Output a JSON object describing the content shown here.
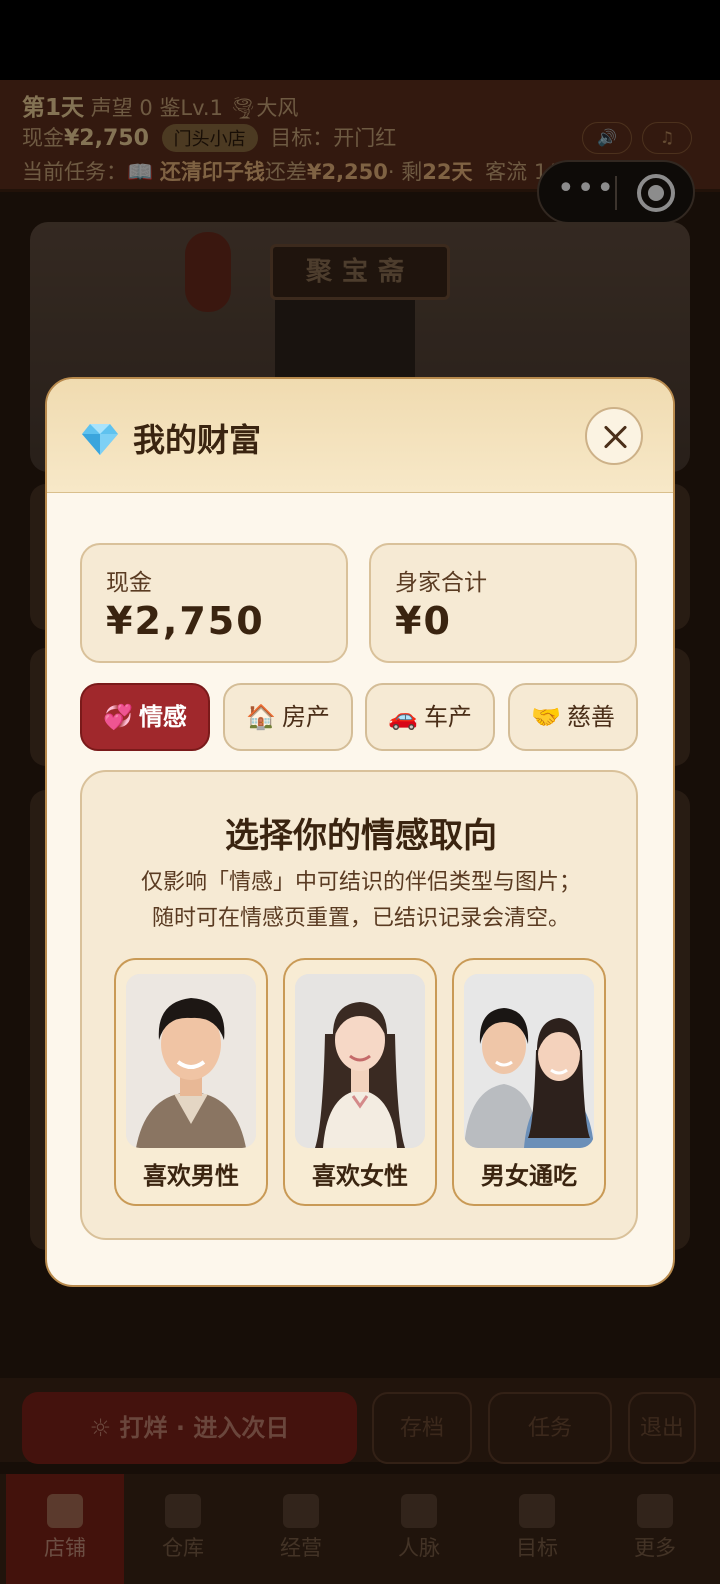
{
  "topbar": {
    "day": "第1天",
    "reputation": "声望 0",
    "appraisal": "鉴Lv.1",
    "weather_icon": "wind-icon",
    "weather": "大风",
    "cash_label": "现金",
    "cash_value": "¥2,750",
    "shop_badge": "门头小店",
    "goal": "目标：开门红",
    "task_label": "当前任务：",
    "task_icon": "book-icon",
    "task_name": "还清印子钱",
    "task_progress": "还差",
    "task_amount": "¥2,250",
    "task_sep": "· 剩",
    "task_days": "22天",
    "customer_count": "客流 1/2"
  },
  "scene": {
    "shop_sign": "聚宝斋"
  },
  "actions": {
    "next_day": "☼ 打烊 · 进入次日",
    "save": "存档",
    "task": "任务",
    "exit": "退出"
  },
  "tabs": [
    {
      "label": "店铺",
      "icon": "shop-icon",
      "active": true
    },
    {
      "label": "仓库",
      "icon": "warehouse-icon"
    },
    {
      "label": "经营",
      "icon": "business-icon"
    },
    {
      "label": "人脉",
      "icon": "people-icon"
    },
    {
      "label": "目标",
      "icon": "target-icon"
    },
    {
      "label": "更多",
      "icon": "more-icon"
    }
  ],
  "modal": {
    "title": "我的财富",
    "title_icon": "gem-icon",
    "cash_label": "现金",
    "cash_value": "¥2,750",
    "networth_label": "身家合计",
    "networth_value": "¥0",
    "categories": [
      {
        "emoji": "💞",
        "label": "情感",
        "active": true
      },
      {
        "emoji": "🏠",
        "label": "房产"
      },
      {
        "emoji": "🚗",
        "label": "车产"
      },
      {
        "emoji": "🤝",
        "label": "慈善"
      }
    ],
    "pref_title": "选择你的情感取向",
    "pref_desc_1": "仅影响「情感」中可结识的伴侣类型与图片；",
    "pref_desc_2": "随时可在情感页重置，已结识记录会清空。",
    "options": [
      {
        "label": "喜欢男性"
      },
      {
        "label": "喜欢女性"
      },
      {
        "label": "男女通吃"
      }
    ]
  }
}
